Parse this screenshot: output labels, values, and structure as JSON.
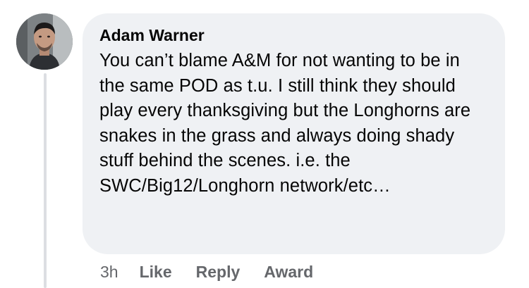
{
  "comment": {
    "author": "Adam Warner",
    "text": "You can’t blame A&M for not wanting to be in the same POD as t.u. I still think they should play every thanksgiving but the Longhorns are snakes in the grass and always doing shady stuff behind the scenes. i.e. the SWC/Big12/Longhorn network/etc…",
    "timestamp": "3h",
    "actions": {
      "like": "Like",
      "reply": "Reply",
      "award": "Award"
    }
  },
  "colors": {
    "bubble_background": "#eff1f4",
    "meta_text": "#65676b",
    "thread_line": "#dcdee2"
  }
}
